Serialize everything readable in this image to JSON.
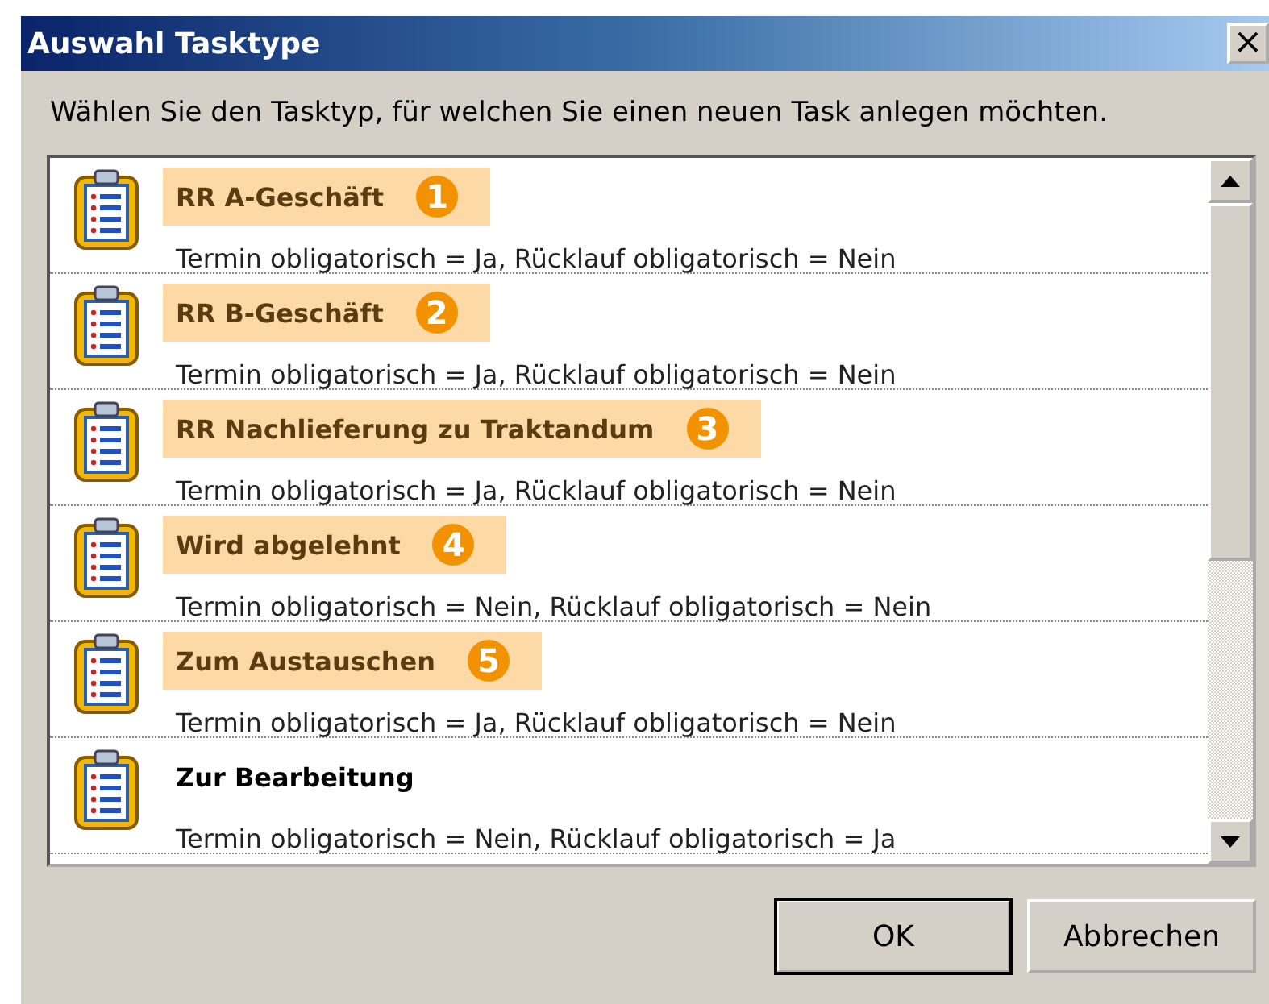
{
  "window": {
    "title": "Auswahl Tasktype",
    "close": "×"
  },
  "instruction": "Wählen Sie den Tasktyp, für welchen Sie einen neuen Task anlegen möchten.",
  "task_types": [
    {
      "name": "RR A-Geschäft",
      "details": "Termin obligatorisch = Ja, Rücklauf obligatorisch = Nein",
      "highlighted": true,
      "marker": "1"
    },
    {
      "name": "RR B-Geschäft",
      "details": "Termin obligatorisch = Ja, Rücklauf obligatorisch = Nein",
      "highlighted": true,
      "marker": "2"
    },
    {
      "name": "RR Nachlieferung zu Traktandum",
      "details": "Termin obligatorisch = Ja, Rücklauf obligatorisch = Nein",
      "highlighted": true,
      "marker": "3"
    },
    {
      "name": "Wird abgelehnt",
      "details": "Termin obligatorisch = Nein, Rücklauf obligatorisch = Nein",
      "highlighted": true,
      "marker": "4"
    },
    {
      "name": "Zum Austauschen",
      "details": "Termin obligatorisch = Ja, Rücklauf obligatorisch = Nein",
      "highlighted": true,
      "marker": "5"
    },
    {
      "name": "Zur Bearbeitung",
      "details": "Termin obligatorisch = Nein, Rücklauf obligatorisch = Ja",
      "highlighted": false
    }
  ],
  "buttons": [
    {
      "label": "OK",
      "default": true
    },
    {
      "label": "Abbrechen",
      "default": false
    }
  ]
}
